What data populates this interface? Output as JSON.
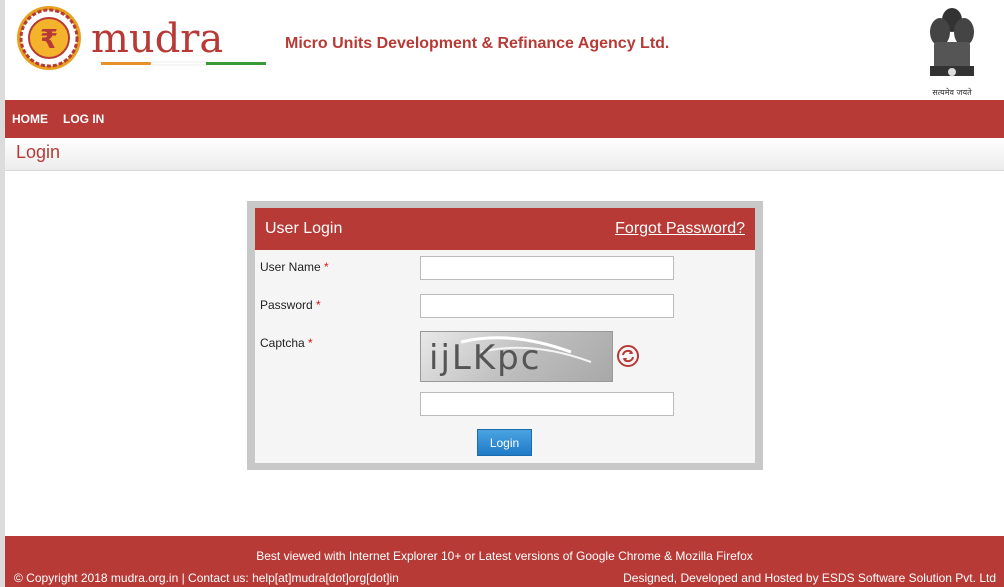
{
  "header": {
    "logo_word": "mudra",
    "agency_name": "Micro Units Development & Refinance Agency Ltd.",
    "emblem_text": "सत्यमेव जयते",
    "accent_color": "#b83a36"
  },
  "nav": {
    "items": [
      {
        "label": "HOME"
      },
      {
        "label": "LOG IN"
      }
    ]
  },
  "page": {
    "title": "Login"
  },
  "login_panel": {
    "title": "User Login",
    "forgot_link": "Forgot Password?",
    "username_label": "User Name",
    "password_label": "Password",
    "captcha_label": "Captcha",
    "required_mark": "*",
    "username_value": "",
    "password_value": "",
    "captcha_value": "",
    "captcha_text": "ijLKpc",
    "refresh_icon": "refresh-icon",
    "login_button": "Login"
  },
  "footer": {
    "best_viewed": "Best viewed with Internet Explorer 10+ or Latest versions of Google Chrome & Mozilla Firefox",
    "copyright": "© Copyright 2018 mudra.org.in | Contact us: help[at]mudra[dot]org[dot]in",
    "designed_by": "Designed, Developed and Hosted by ESDS Software Solution Pvt. Ltd"
  }
}
